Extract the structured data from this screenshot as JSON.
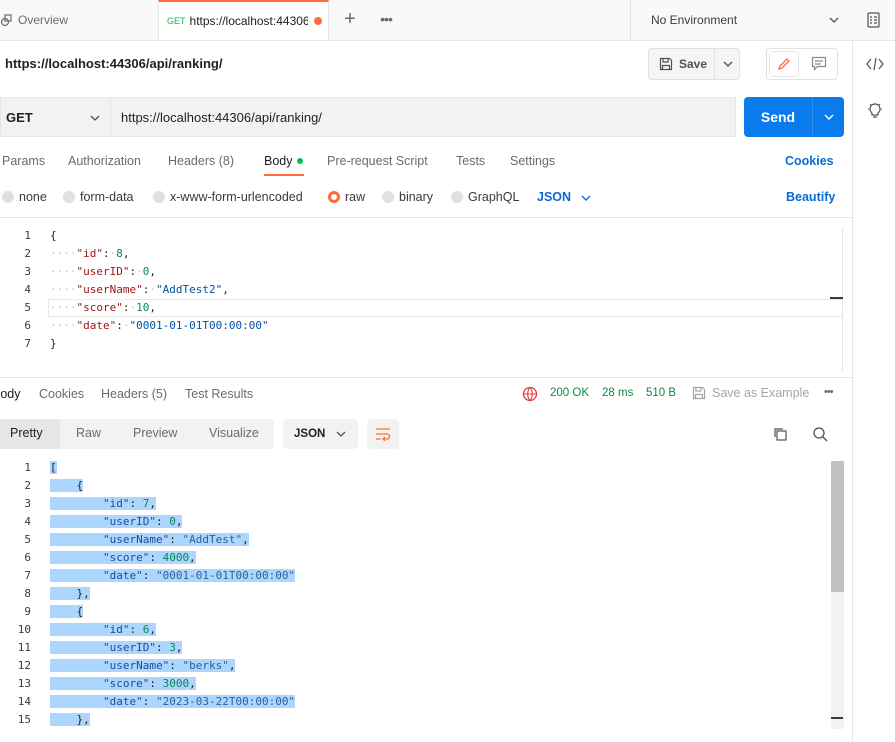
{
  "tabs": {
    "overview_label": "Overview",
    "active_method": "GET",
    "active_url": "https://localhost:44306",
    "environment": "No Environment"
  },
  "request": {
    "title": "https://localhost:44306/api/ranking/",
    "save_label": "Save",
    "method": "GET",
    "url": "https://localhost:44306/api/ranking/",
    "send_label": "Send",
    "tabs": [
      "Params",
      "Authorization",
      "Headers (8)",
      "Body",
      "Pre-request Script",
      "Tests",
      "Settings"
    ],
    "cookies_label": "Cookies",
    "body_types": [
      "none",
      "form-data",
      "x-www-form-urlencoded",
      "raw",
      "binary",
      "GraphQL"
    ],
    "body_format": "JSON",
    "beautify_label": "Beautify",
    "body_lines": [
      {
        "n": "1",
        "text": "{"
      },
      {
        "n": "2",
        "key": "\"id\"",
        "val": "8"
      },
      {
        "n": "3",
        "key": "\"userID\"",
        "val": "0"
      },
      {
        "n": "4",
        "key": "\"userName\"",
        "val": "\"AddTest2\""
      },
      {
        "n": "5",
        "key": "\"score\"",
        "val": "10"
      },
      {
        "n": "6",
        "key": "\"date\"",
        "val": "\"0001-01-01T00:00:00\""
      },
      {
        "n": "7",
        "text": "}"
      }
    ]
  },
  "response": {
    "tabs": [
      "Body",
      "Cookies",
      "Headers (5)",
      "Test Results"
    ],
    "status": "200 OK",
    "time": "28 ms",
    "size": "510 B",
    "save_example_label": "Save as Example",
    "views": [
      "Pretty",
      "Raw",
      "Preview",
      "Visualize"
    ],
    "format": "JSON",
    "lines": [
      {
        "n": "1",
        "text": "["
      },
      {
        "n": "2",
        "text": "{"
      },
      {
        "n": "3",
        "key": "\"id\"",
        "val": "7"
      },
      {
        "n": "4",
        "key": "\"userID\"",
        "val": "0"
      },
      {
        "n": "5",
        "key": "\"userName\"",
        "val": "\"AddTest\""
      },
      {
        "n": "6",
        "key": "\"score\"",
        "val": "4000"
      },
      {
        "n": "7",
        "key": "\"date\"",
        "val": "\"0001-01-01T00:00:00\""
      },
      {
        "n": "8",
        "text": "},"
      },
      {
        "n": "9",
        "text": "{"
      },
      {
        "n": "10",
        "key": "\"id\"",
        "val": "6"
      },
      {
        "n": "11",
        "key": "\"userID\"",
        "val": "3"
      },
      {
        "n": "12",
        "key": "\"userName\"",
        "val": "\"berks\""
      },
      {
        "n": "13",
        "key": "\"score\"",
        "val": "3000"
      },
      {
        "n": "14",
        "key": "\"date\"",
        "val": "\"2023-03-22T00:00:00\""
      },
      {
        "n": "15",
        "text": "},"
      }
    ]
  },
  "colors": {
    "accent": "#ff6c37",
    "send": "#097bed",
    "link": "#0b6ad5",
    "status_ok": "#0d8a43",
    "selection": "#add6ff"
  }
}
